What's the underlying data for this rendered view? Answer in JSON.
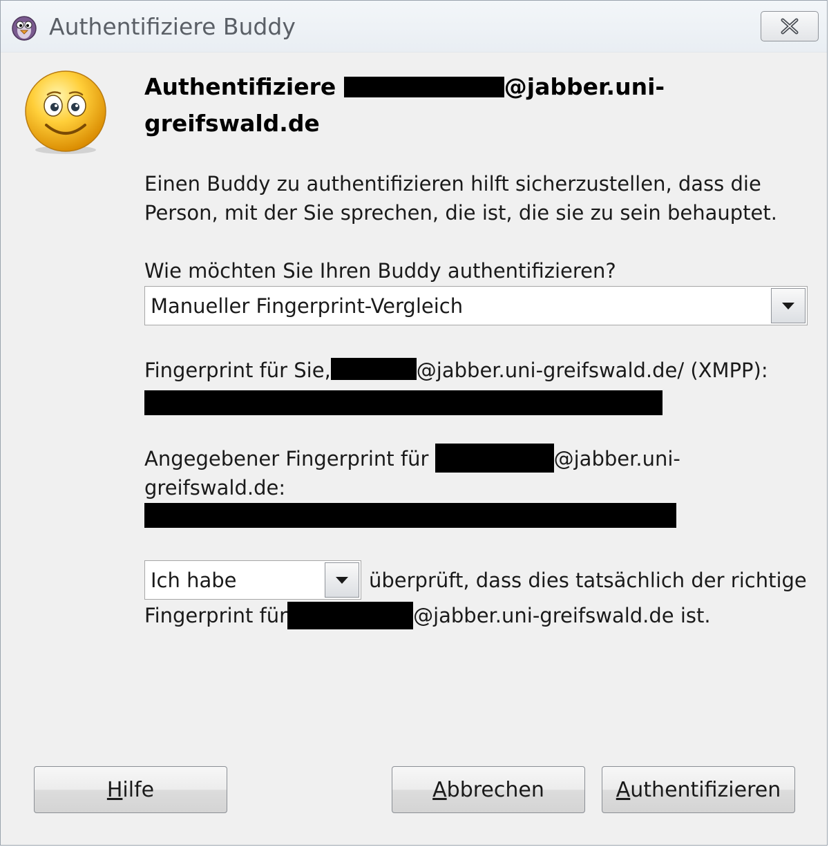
{
  "window": {
    "title": "Authentifiziere Buddy"
  },
  "icons": {
    "app": "pidgin-icon",
    "close": "close-icon",
    "smiley": "smiley-icon",
    "dropdown": "chevron-down-icon"
  },
  "heading": {
    "prefix": "Authentifiziere ",
    "suffix": "@jabber.uni-",
    "line2": "greifswald.de"
  },
  "intro": {
    "line1": "Einen Buddy zu authentifizieren hilft sicherzustellen, dass die",
    "line2": "Person, mit der Sie sprechen, die ist, die sie zu sein behauptet."
  },
  "method": {
    "label": "Wie möchten Sie Ihren Buddy authentifizieren?",
    "selected": "Manueller Fingerprint-Vergleich"
  },
  "own_fingerprint": {
    "label_prefix": "Fingerprint für Sie,",
    "label_suffix": "@jabber.uni-greifswald.de/ (XMPP):"
  },
  "buddy_fingerprint": {
    "label_prefix": "Angegebener Fingerprint für ",
    "label_suffix": "@jabber.uni-",
    "label_line2": "greifswald.de:"
  },
  "verification": {
    "selected": "Ich habe",
    "text_line1": "überprüft, dass dies tatsächlich der richtige",
    "text_line2_prefix": "Fingerprint für",
    "text_line2_suffix": "@jabber.uni-greifswald.de ist."
  },
  "buttons": {
    "help": {
      "accel": "H",
      "rest": "ilfe"
    },
    "cancel": {
      "accel": "A",
      "rest": "bbrechen"
    },
    "authenticate": {
      "accel": "A",
      "rest": "uthentifizieren"
    }
  },
  "colors": {
    "window_bg": "#f0f0f0",
    "titlebar_bg": "#eaeef2",
    "redaction": "#000000"
  }
}
